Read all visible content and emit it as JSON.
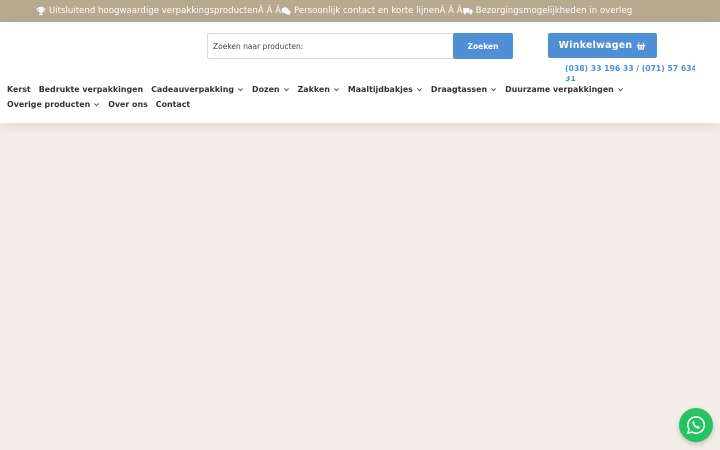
{
  "topbar": {
    "usp1": "Uitsluitend hoogwaardige verpakkingsproductenÂ  Â Â ",
    "usp2": "Persoonlijk contact en korte lijnenÂ  Â Â ",
    "usp3": "Bezorgingsmogelijkheden in overleg",
    "icons": [
      "trophy-icon",
      "chat-icon",
      "truck-icon"
    ]
  },
  "search": {
    "placeholder": "Zoeken naar producten:",
    "button_label": "Zoeken"
  },
  "cart": {
    "label": "Winkelwagen",
    "icon": "basket-icon"
  },
  "contact": {
    "phone": "(038) 33 196 33 / (071) 57 634",
    "phone_overflow": "31"
  },
  "nav": {
    "row1": [
      {
        "label": "Kerst",
        "dropdown": false
      },
      {
        "label": "Bedrukte verpakkingen",
        "dropdown": false
      },
      {
        "label": "Cadeauverpakking",
        "dropdown": true
      },
      {
        "label": "Dozen",
        "dropdown": true
      },
      {
        "label": "Zakken",
        "dropdown": true
      },
      {
        "label": "Maaltijdbakjes",
        "dropdown": true
      },
      {
        "label": "Draagtassen",
        "dropdown": true
      },
      {
        "label": "Duurzame verpakkingen",
        "dropdown": true
      }
    ],
    "row2": [
      {
        "label": "Overige producten",
        "dropdown": true
      },
      {
        "label": "Over ons",
        "dropdown": false
      },
      {
        "label": "Contact",
        "dropdown": false
      }
    ]
  },
  "whatsapp": {
    "icon": "whatsapp-icon"
  },
  "colors": {
    "topbar": "#b7a98f",
    "accent": "#4f8fd3",
    "page_bg": "#f2ede6",
    "whatsapp": "#27c263"
  }
}
